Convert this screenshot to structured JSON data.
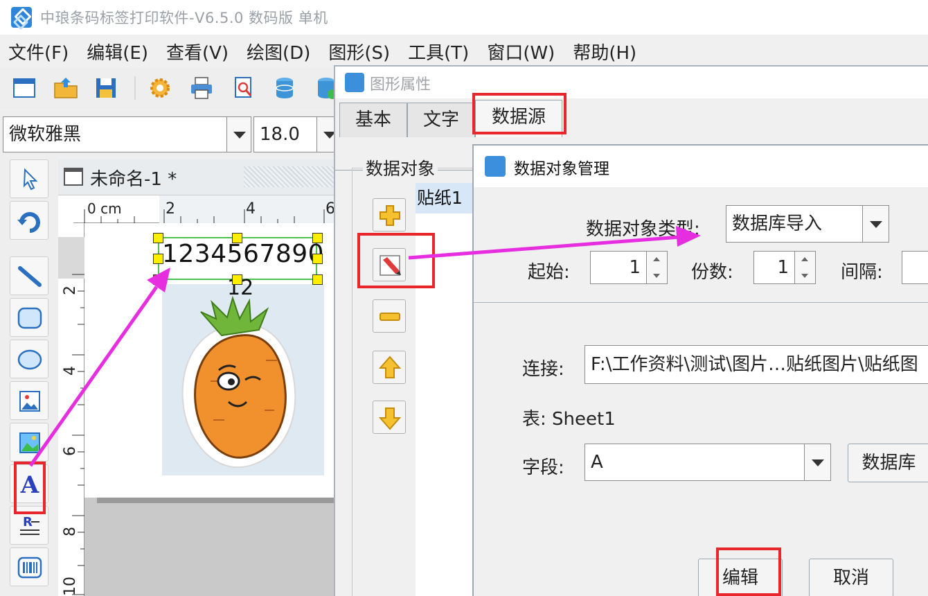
{
  "window": {
    "title": "中琅条码标签打印软件-V6.5.0 数码版 单机"
  },
  "menu": [
    "文件(F)",
    "编辑(E)",
    "查看(V)",
    "绘图(D)",
    "图形(S)",
    "工具(T)",
    "窗口(W)",
    "帮助(H)"
  ],
  "fontbar": {
    "font_name": "微软雅黑",
    "font_size": "18.0"
  },
  "document": {
    "tab_name": "未命名-1 *"
  },
  "ruler": {
    "unit": "0 cm",
    "h_ticks": [
      "2",
      "4",
      "6"
    ],
    "v_ticks": [
      "2",
      "4",
      "6",
      "8",
      "10"
    ]
  },
  "label": {
    "barcode_text": "1234567890",
    "sub_text": "12"
  },
  "props_dialog": {
    "title": "图形属性",
    "tabs": [
      "基本",
      "文字",
      "数据源"
    ],
    "active_tab": "数据源",
    "group_label": "数据对象",
    "objects": [
      "贴纸1"
    ]
  },
  "data_manager": {
    "title": "数据对象管理",
    "type_label": "数据对象类型:",
    "type_value": "数据库导入",
    "start_label": "起始:",
    "start_value": "1",
    "copies_label": "份数:",
    "copies_value": "1",
    "interval_label": "间隔:",
    "interval_value": "",
    "connect_label": "连接:",
    "connect_value": "F:\\工作资料\\测试\\图片…贴纸图片\\贴纸图",
    "table_text": "表: Sheet1",
    "field_label": "字段:",
    "field_value": "A",
    "db_button": "数据库",
    "edit_button": "编辑",
    "cancel_button": "取消"
  },
  "colors": {
    "highlight": "#e8262b",
    "arrow": "#e62ee0",
    "accent": "#3b8fdb",
    "selection": "#4dc04d"
  }
}
